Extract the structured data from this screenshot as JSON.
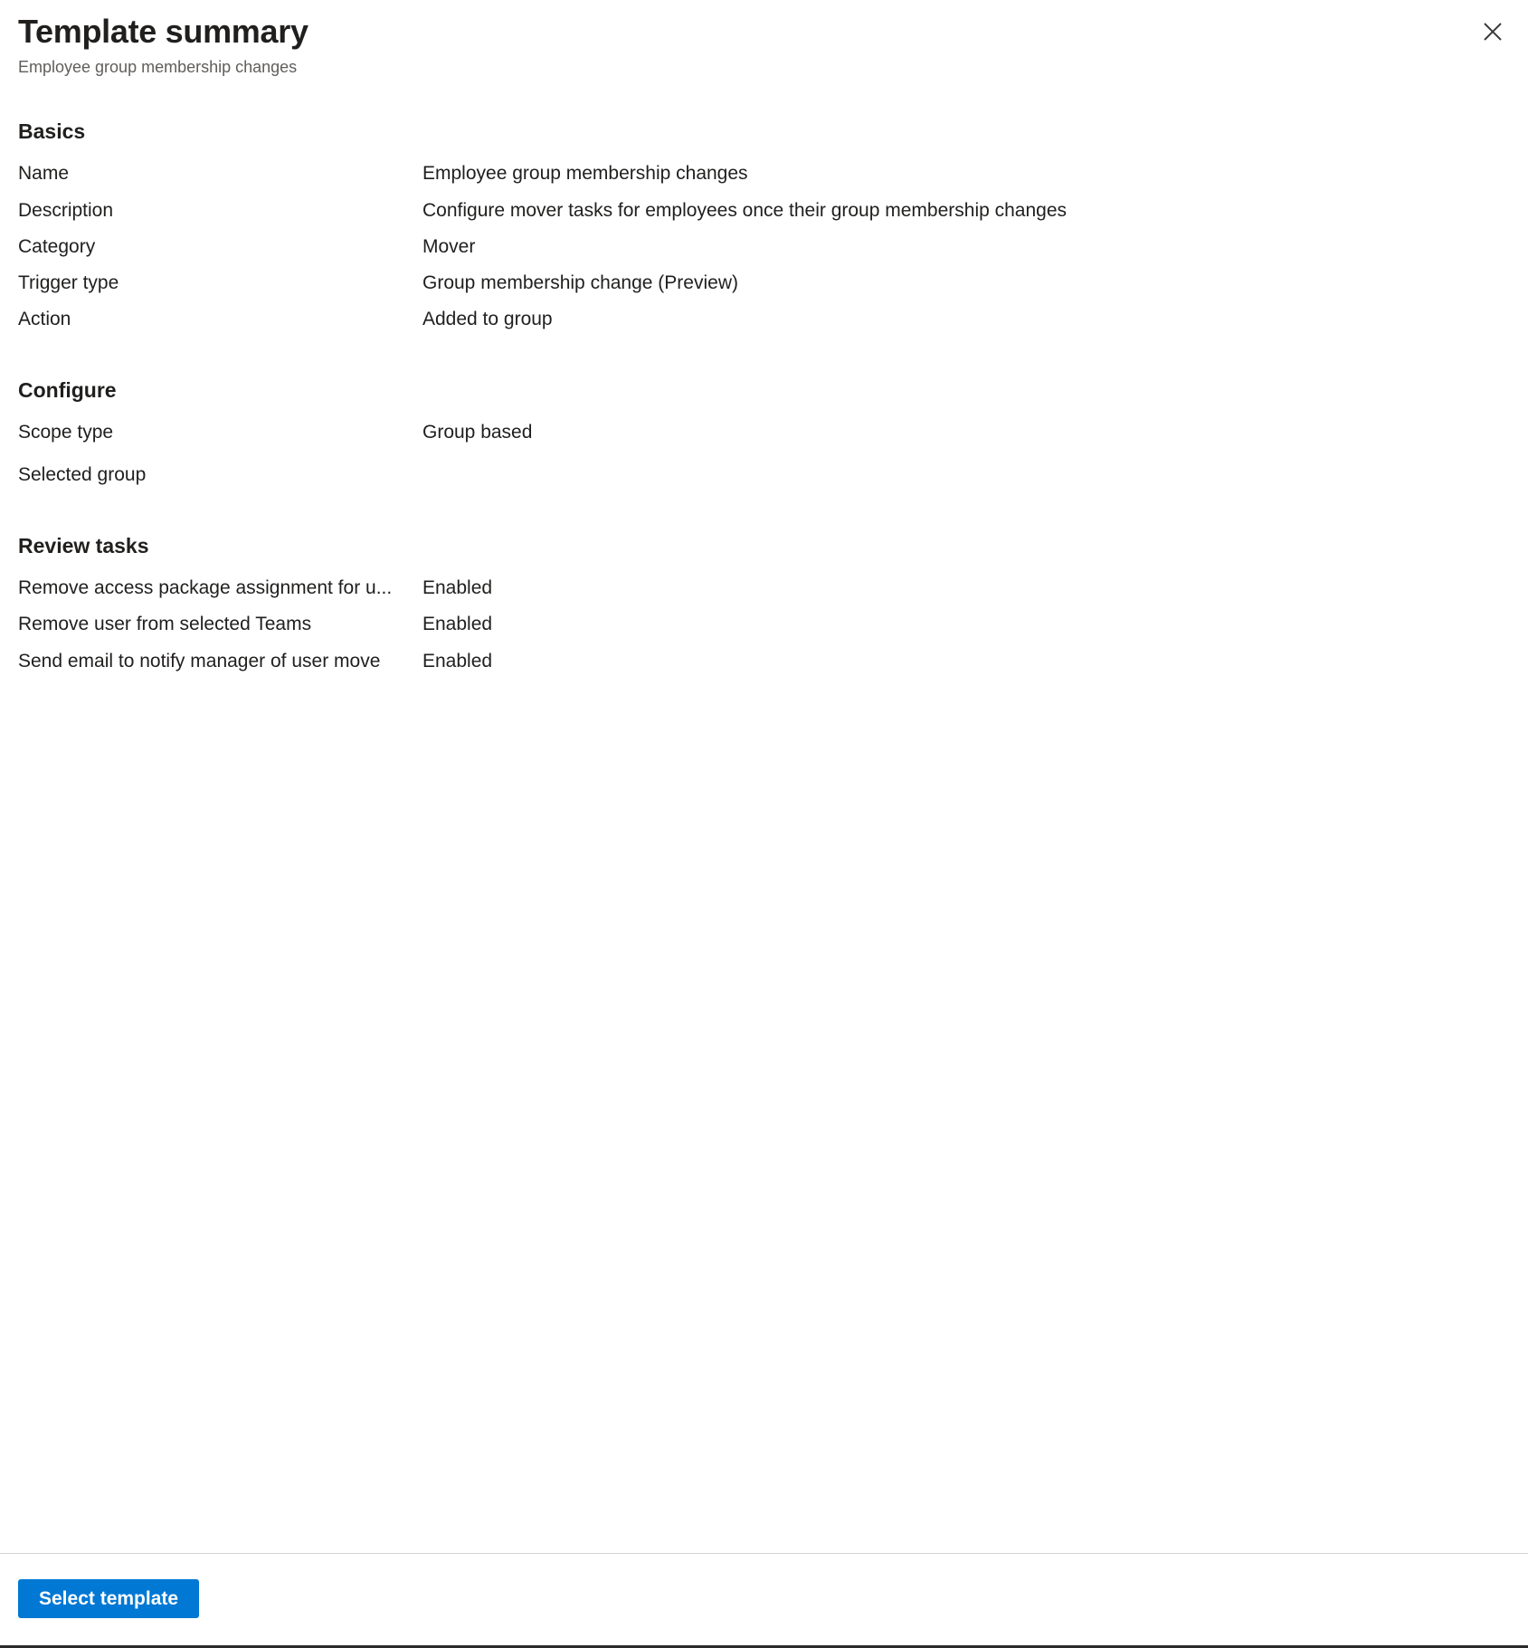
{
  "header": {
    "title": "Template summary",
    "subtitle": "Employee group membership changes",
    "close_icon": "close-icon"
  },
  "sections": [
    {
      "id": "basics",
      "title": "Basics",
      "rows": [
        {
          "label": "Name",
          "value": "Employee group membership changes"
        },
        {
          "label": "Description",
          "value": "Configure mover tasks for employees once their group membership changes"
        },
        {
          "label": "Category",
          "value": "Mover"
        },
        {
          "label": "Trigger type",
          "value": "Group membership change (Preview)"
        },
        {
          "label": "Action",
          "value": "Added to group"
        }
      ]
    },
    {
      "id": "configure",
      "title": "Configure",
      "rows": [
        {
          "label": "Scope type",
          "value": "Group based"
        },
        {
          "label": "Selected group",
          "value": ""
        }
      ]
    },
    {
      "id": "review-tasks",
      "title": "Review tasks",
      "rows": [
        {
          "label": "Remove access package assignment for u...",
          "value": "Enabled"
        },
        {
          "label": "Remove user from selected Teams",
          "value": "Enabled"
        },
        {
          "label": "Send email to notify manager of user move",
          "value": "Enabled"
        }
      ]
    }
  ],
  "footer": {
    "select_template_label": "Select template"
  },
  "colors": {
    "accent": "#0078d4",
    "text_primary": "#201f1e",
    "text_secondary": "#605e5c",
    "divider": "#d6d6d6"
  }
}
